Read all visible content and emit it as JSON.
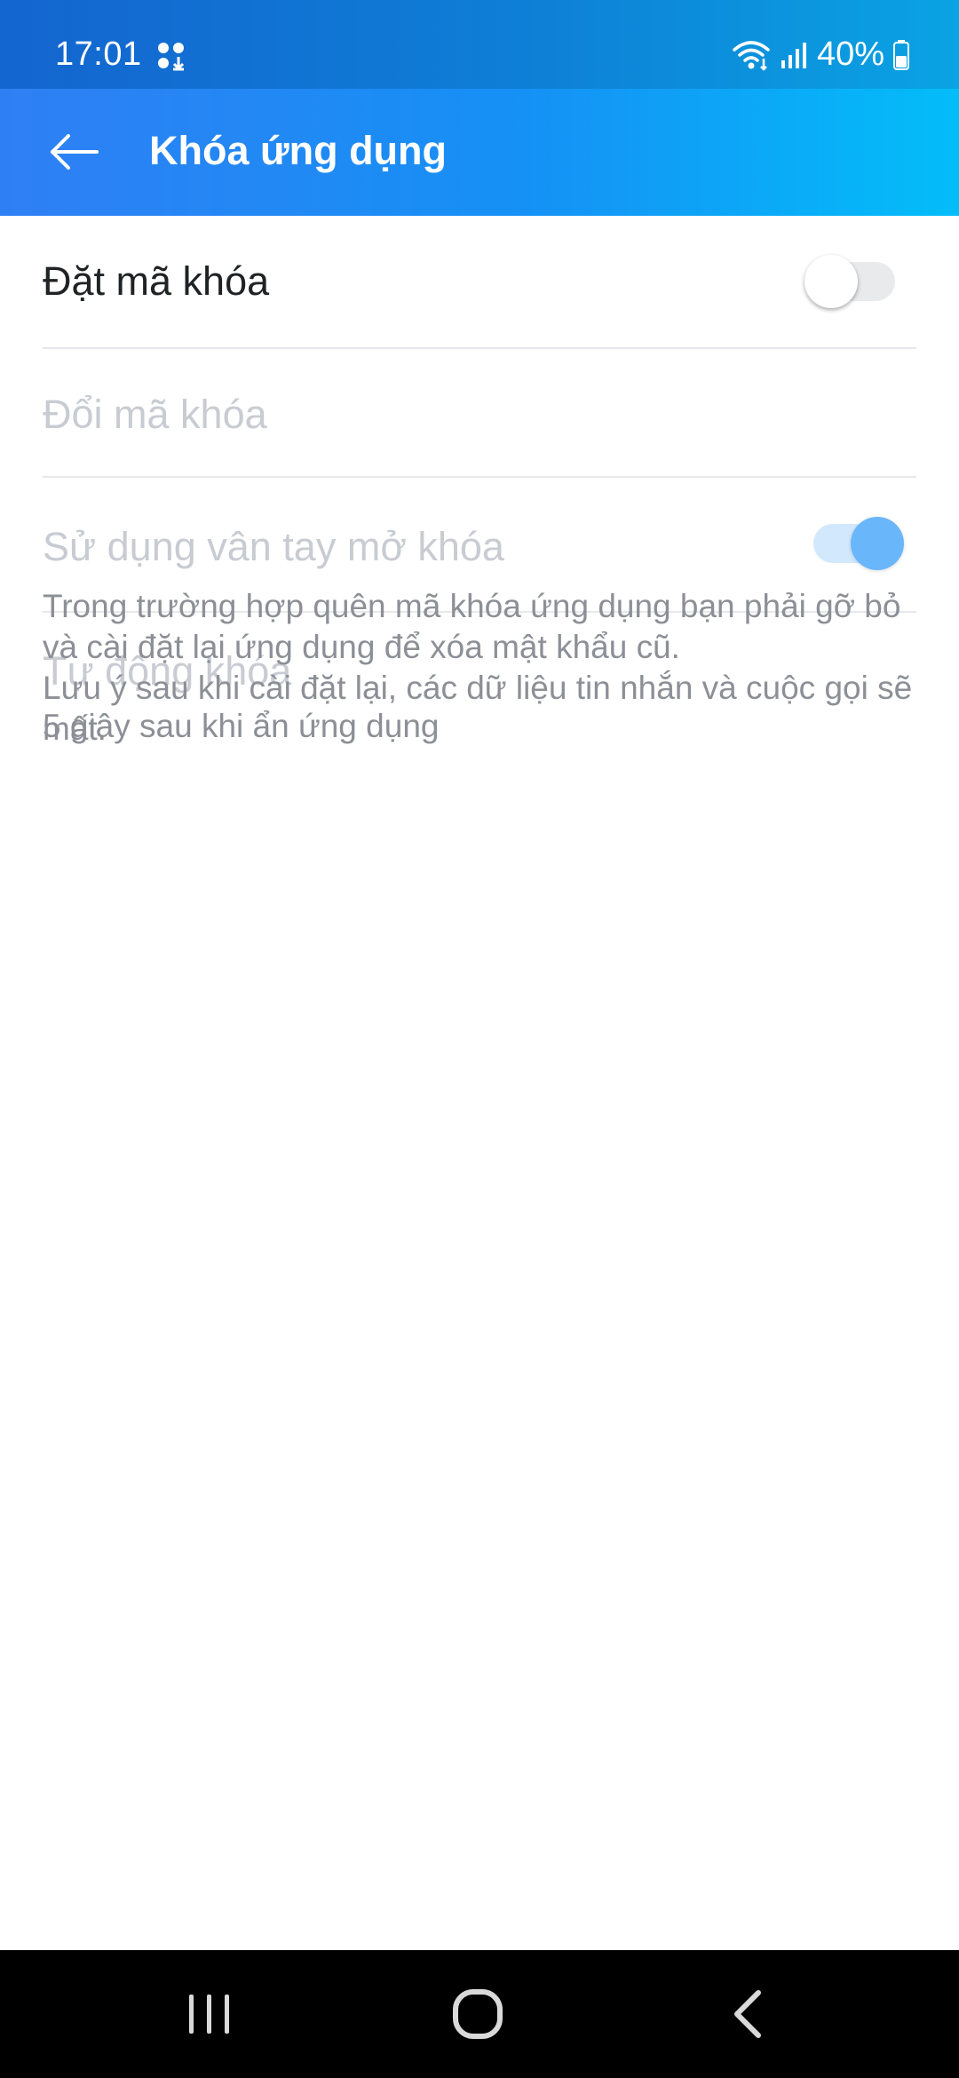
{
  "status_bar": {
    "time": "17:01",
    "battery": "40%",
    "notification_icon": "apps-icon",
    "icons": [
      "wifi-icon",
      "signal-icon",
      "battery-icon"
    ]
  },
  "app_bar": {
    "title": "Khóa ứng dụng",
    "back_icon": "arrow-left-icon",
    "gradient": [
      "#2f7ff4",
      "#03bdf9"
    ]
  },
  "settings": {
    "set_lock_code": {
      "label": "Đặt mã khóa",
      "toggle_on": false,
      "enabled": true
    },
    "change_lock_code": {
      "label": "Đổi mã khóa",
      "enabled": false
    },
    "fingerprint_unlock": {
      "label": "Sử dụng vân tay mở khóa",
      "toggle_on": true,
      "enabled": false
    },
    "auto_lock": {
      "label": "Tự động khóa",
      "value": "5 giây sau khi ẩn ứng dụng",
      "enabled": false
    }
  },
  "note": {
    "line1": "Trong trường hợp quên mã khóa ứng dụng bạn phải gỡ bỏ và cài đặt lại ứng dụng để xóa mật khẩu cũ.",
    "line2": "Lưu ý sau khi cài đặt lại, các dữ liệu tin nhắn và cuộc gọi sẽ mất."
  },
  "nav_bar": {
    "icons": [
      "recents-icon",
      "home-icon",
      "back-icon"
    ]
  },
  "colors": {
    "primary_text": "#1f2326",
    "disabled_text": "#c8ccd2",
    "secondary_text": "#8c9096",
    "toggle_on": "#6ab6fb"
  }
}
